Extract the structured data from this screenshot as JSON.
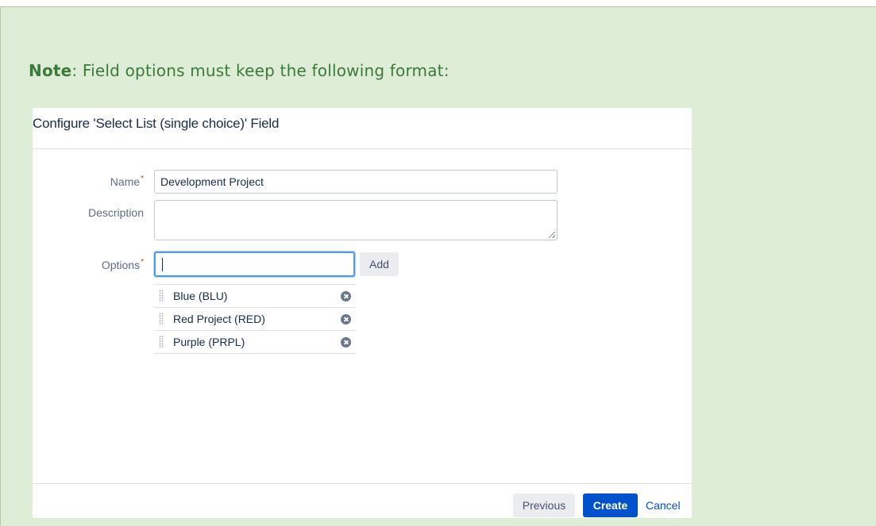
{
  "note": {
    "label": "Note",
    "text": ": Field options must keep the following format:"
  },
  "dialog": {
    "title": "Configure 'Select List (single choice)' Field",
    "fields": {
      "name_label": "Name",
      "name_value": "Development Project",
      "description_label": "Description",
      "description_value": "",
      "options_label": "Options",
      "options_value": "",
      "required_marker": "*"
    },
    "add_label": "Add",
    "options": [
      {
        "label": "Blue (BLU)"
      },
      {
        "label": "Red Project (RED)"
      },
      {
        "label": "Purple (PRPL)"
      }
    ],
    "footer": {
      "previous_label": "Previous",
      "create_label": "Create",
      "cancel_label": "Cancel"
    }
  },
  "colors": {
    "note_background": "#deedd6",
    "note_text": "#3c7a3a",
    "primary": "#0052cc",
    "required": "#de350b",
    "focus_ring": "#4c9aff"
  },
  "icons": {
    "drag": "drag-handle-icon",
    "remove": "remove-option-icon"
  }
}
